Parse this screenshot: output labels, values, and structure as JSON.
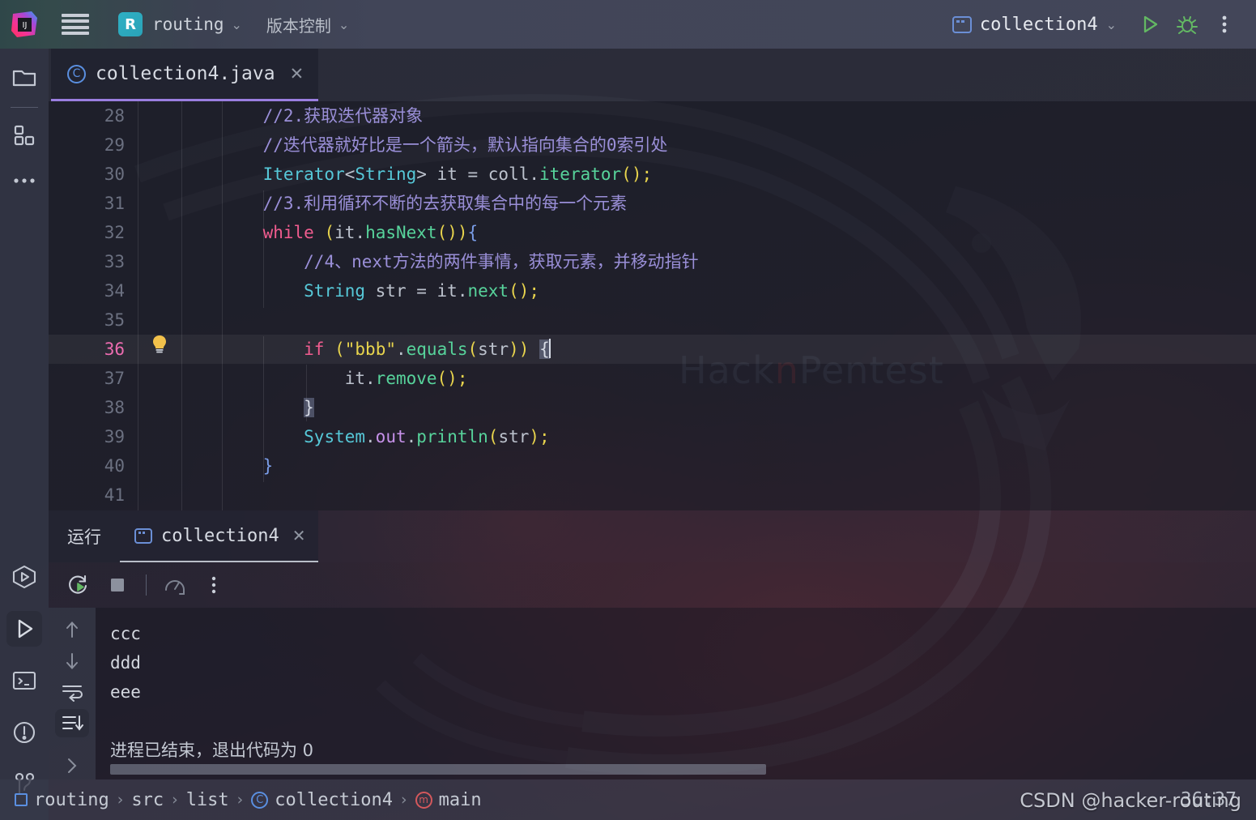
{
  "titlebar": {
    "logo_icon": "intellij-idea-logo",
    "menu_icon": "hamburger-menu-icon",
    "project_initial": "R",
    "project_name": "routing",
    "vcs_label": "版本控制",
    "chevron": "⌄",
    "run_config": "collection4",
    "run_icon": "run-play-icon",
    "debug_icon": "debug-bug-icon",
    "more_icon": "more-vertical-icon"
  },
  "rail": {
    "top": [
      {
        "name": "project-folder",
        "icon": "folder-icon"
      },
      {
        "name": "structure",
        "icon": "structure-blocks-icon"
      },
      {
        "name": "more-tool-windows",
        "icon": "ellipsis-icon"
      }
    ],
    "bottom": [
      {
        "name": "run-anything",
        "icon": "hexagon-play-icon"
      },
      {
        "name": "run-tool-window",
        "icon": "play-icon",
        "active": true
      },
      {
        "name": "terminal",
        "icon": "terminal-icon"
      },
      {
        "name": "problems",
        "icon": "exclamation-circle-icon"
      },
      {
        "name": "version-control-branch",
        "icon": "git-branch-icon"
      }
    ]
  },
  "editor": {
    "tab": {
      "icon": "java-class-icon",
      "label": "collection4.java",
      "close": "✕"
    },
    "first_line_number": 28,
    "current_line": 36,
    "lines": [
      {
        "n": 28,
        "tokens": [
          {
            "t": "    ",
            "c": "c-plain"
          },
          {
            "t": "//2.获取迭代器对象",
            "c": "c-com"
          }
        ]
      },
      {
        "n": 29,
        "tokens": [
          {
            "t": "    ",
            "c": "c-plain"
          },
          {
            "t": "//迭代器就好比是一个箭头，默认指向集合的0索引处",
            "c": "c-com"
          }
        ]
      },
      {
        "n": 30,
        "tokens": [
          {
            "t": "    ",
            "c": "c-plain"
          },
          {
            "t": "Iterator",
            "c": "c-type"
          },
          {
            "t": "<",
            "c": "c-plain"
          },
          {
            "t": "String",
            "c": "c-type"
          },
          {
            "t": "> ",
            "c": "c-plain"
          },
          {
            "t": "it",
            "c": "c-plain"
          },
          {
            "t": " = ",
            "c": "c-plain"
          },
          {
            "t": "coll",
            "c": "c-plain"
          },
          {
            "t": ".",
            "c": "c-plain"
          },
          {
            "t": "iterator",
            "c": "c-meth"
          },
          {
            "t": "()",
            "c": "c-paren"
          },
          {
            "t": ";",
            "c": "c-paren"
          }
        ]
      },
      {
        "n": 31,
        "tokens": [
          {
            "t": "    ",
            "c": "c-plain"
          },
          {
            "t": "//3.利用循环不断的去获取集合中的每一个元素",
            "c": "c-com"
          }
        ]
      },
      {
        "n": 32,
        "tokens": [
          {
            "t": "    ",
            "c": "c-plain"
          },
          {
            "t": "while",
            "c": "c-kw"
          },
          {
            "t": " ",
            "c": "c-plain"
          },
          {
            "t": "(",
            "c": "c-paren"
          },
          {
            "t": "it",
            "c": "c-plain"
          },
          {
            "t": ".",
            "c": "c-plain"
          },
          {
            "t": "hasNext",
            "c": "c-meth"
          },
          {
            "t": "()",
            "c": "c-paren"
          },
          {
            "t": ")",
            "c": "c-paren"
          },
          {
            "t": "{",
            "c": "c-brace"
          }
        ]
      },
      {
        "n": 33,
        "tokens": [
          {
            "t": "        ",
            "c": "c-plain"
          },
          {
            "t": "//4、next方法的两件事情，获取元素，并移动指针",
            "c": "c-com"
          }
        ]
      },
      {
        "n": 34,
        "tokens": [
          {
            "t": "        ",
            "c": "c-plain"
          },
          {
            "t": "String",
            "c": "c-type"
          },
          {
            "t": " str",
            "c": "c-plain"
          },
          {
            "t": " = ",
            "c": "c-plain"
          },
          {
            "t": "it",
            "c": "c-plain"
          },
          {
            "t": ".",
            "c": "c-plain"
          },
          {
            "t": "next",
            "c": "c-meth"
          },
          {
            "t": "()",
            "c": "c-paren"
          },
          {
            "t": ";",
            "c": "c-paren"
          }
        ]
      },
      {
        "n": 35,
        "tokens": []
      },
      {
        "n": 36,
        "bulb": "intention-bulb-icon",
        "tokens": [
          {
            "t": "        ",
            "c": "c-plain"
          },
          {
            "t": "if",
            "c": "c-kw"
          },
          {
            "t": " ",
            "c": "c-plain"
          },
          {
            "t": "(",
            "c": "c-paren"
          },
          {
            "t": "\"bbb\"",
            "c": "c-str"
          },
          {
            "t": ".",
            "c": "c-plain"
          },
          {
            "t": "equals",
            "c": "c-meth"
          },
          {
            "t": "(",
            "c": "c-paren"
          },
          {
            "t": "str",
            "c": "c-plain"
          },
          {
            "t": ")",
            "c": "c-paren"
          },
          {
            "t": ")",
            "c": "c-paren"
          },
          {
            "t": " ",
            "c": "c-plain"
          },
          {
            "t": "{",
            "c": "c-brace-hl"
          }
        ]
      },
      {
        "n": 37,
        "tokens": [
          {
            "t": "            ",
            "c": "c-plain"
          },
          {
            "t": "it",
            "c": "c-plain"
          },
          {
            "t": ".",
            "c": "c-plain"
          },
          {
            "t": "remove",
            "c": "c-meth"
          },
          {
            "t": "()",
            "c": "c-paren"
          },
          {
            "t": ";",
            "c": "c-paren"
          }
        ]
      },
      {
        "n": 38,
        "tokens": [
          {
            "t": "        ",
            "c": "c-plain"
          },
          {
            "t": "}",
            "c": "c-brace-hl"
          }
        ]
      },
      {
        "n": 39,
        "tokens": [
          {
            "t": "        ",
            "c": "c-plain"
          },
          {
            "t": "System",
            "c": "c-type"
          },
          {
            "t": ".",
            "c": "c-plain"
          },
          {
            "t": "out",
            "c": "c-field"
          },
          {
            "t": ".",
            "c": "c-plain"
          },
          {
            "t": "println",
            "c": "c-meth"
          },
          {
            "t": "(",
            "c": "c-paren"
          },
          {
            "t": "str",
            "c": "c-plain"
          },
          {
            "t": ")",
            "c": "c-paren"
          },
          {
            "t": ";",
            "c": "c-paren"
          }
        ]
      },
      {
        "n": 40,
        "tokens": [
          {
            "t": "    ",
            "c": "c-plain"
          },
          {
            "t": "}",
            "c": "c-brace"
          }
        ]
      },
      {
        "n": 41,
        "tokens": []
      }
    ]
  },
  "run_panel": {
    "tool_label": "运行",
    "tab_label": "collection4",
    "tab_close": "✕",
    "toolbar": [
      {
        "name": "rerun-button",
        "icon": "rerun-icon"
      },
      {
        "name": "stop-button",
        "icon": "stop-square-icon"
      },
      {
        "name": "profiler-button",
        "icon": "gauge-icon"
      },
      {
        "name": "more-options-button",
        "icon": "more-vertical-icon"
      }
    ],
    "console_rail": [
      {
        "name": "scroll-up-button",
        "icon": "arrow-up-icon"
      },
      {
        "name": "scroll-down-button",
        "icon": "arrow-down-icon"
      },
      {
        "name": "soft-wrap-button",
        "icon": "soft-wrap-icon"
      },
      {
        "name": "scroll-to-end-button",
        "icon": "scroll-to-end-icon",
        "active": true
      },
      {
        "name": "expand-button",
        "icon": "chevron-right-icon"
      }
    ],
    "console_lines": [
      {
        "text": "ccc",
        "cn": false
      },
      {
        "text": "ddd",
        "cn": false
      },
      {
        "text": "eee",
        "cn": false
      },
      {
        "text": "",
        "cn": false
      },
      {
        "text": "进程已结束，退出代码为 0",
        "cn": true
      }
    ]
  },
  "statusbar": {
    "breadcrumbs": [
      {
        "label": "routing",
        "icon": "project-module-icon"
      },
      {
        "label": "src",
        "icon": null
      },
      {
        "label": "list",
        "icon": null
      },
      {
        "label": "collection4",
        "icon": "java-class-icon"
      },
      {
        "label": "main",
        "icon": "java-method-icon"
      }
    ],
    "separator": "›",
    "caret_position": "36:37"
  },
  "watermark": {
    "csdn": "CSDN @hacker-routing",
    "wallpaper_text": "HacknPentest",
    "wallpaper_accent_letter": "n"
  },
  "colors": {
    "accent_purple": "#9a7ee0",
    "keyword_pink": "#f05c8f",
    "type_cyan": "#56c8d8",
    "method_green": "#57d39b",
    "string_yellow": "#e8d44d",
    "comment_lavender": "#9a8fd8",
    "run_green": "#5aa85a",
    "wallpaper_red": "#9a2f36"
  }
}
